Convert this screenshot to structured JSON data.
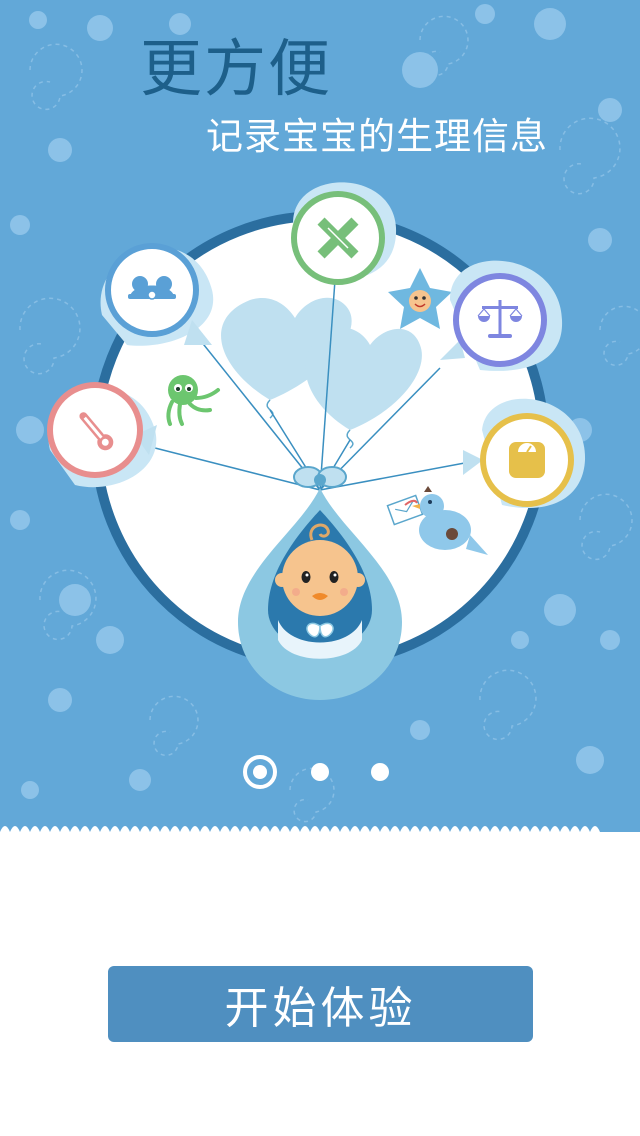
{
  "intro": {
    "headline": "更方便",
    "subline": "记录宝宝的生理信息"
  },
  "feature_icons": [
    {
      "name": "thermometer-icon",
      "ring_color": "#e88e8e"
    },
    {
      "name": "hat-icon",
      "ring_color": "#5aa0d6"
    },
    {
      "name": "ruler-pencil-icon",
      "ring_color": "#77bf7a"
    },
    {
      "name": "balance-scale-icon",
      "ring_color": "#7e86e0"
    },
    {
      "name": "weighing-scale-icon",
      "ring_color": "#e6c04a"
    }
  ],
  "pager": {
    "count": 3,
    "active_index": 0
  },
  "cta": {
    "label": "开始体验"
  },
  "colors": {
    "hero_background": "#62a8d8",
    "headline": "#1d5f8a",
    "button": "#4f8fc0",
    "circle_border": "#2b6e9f"
  }
}
